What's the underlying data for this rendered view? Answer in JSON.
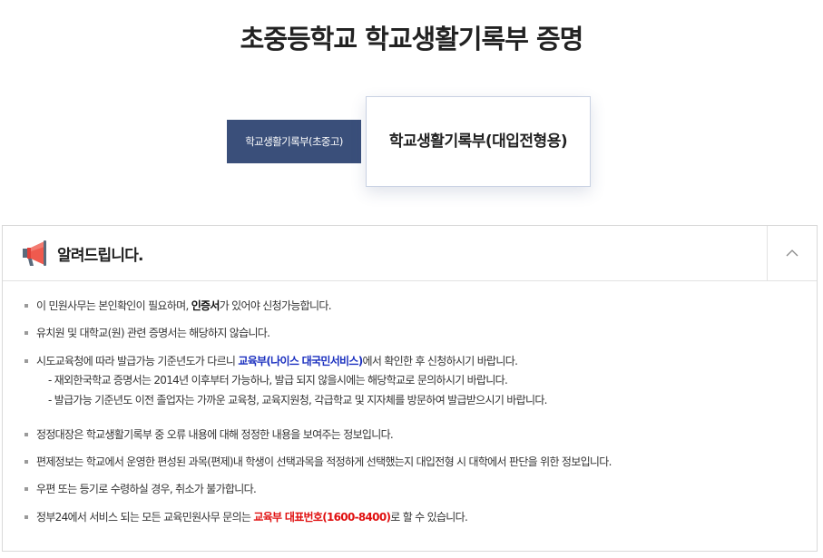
{
  "page": {
    "title": "초중등학교 학교생활기록부 증명"
  },
  "tabs": {
    "basic_label": "학교생활기록부(초중고)",
    "admission_label": "학교생활기록부(대입전형용)"
  },
  "notice": {
    "header_title": "알려드립니다.",
    "items": [
      {
        "pre": "이 민원사무는 본인확인이 필요하며, ",
        "em": "인증서",
        "post": "가 있어야 신청가능합니다."
      },
      {
        "text": "유치원 및 대학교(원) 관련 증명서는 해당하지 않습니다."
      },
      {
        "pre": "시도교육청에 따라 발급가능 기준년도가 다르니 ",
        "em": "교육부(나이스 대국민서비스)",
        "post": "에서 확인한 후 신청하시기 바랍니다."
      },
      {
        "text": "정정대장은 학교생활기록부 중 오류 내용에 대해 정정한 내용을 보여주는 정보입니다."
      },
      {
        "text": "편제정보는 학교에서 운영한 편성된 과목(편제)내 학생이 선택과목을 적정하게 선택했는지 대입전형 시 대학에서 판단을 위한 정보입니다."
      },
      {
        "text": "우편 또는 등기로 수령하실 경우, 취소가 불가합니다."
      },
      {
        "pre": "정부24에서 서비스 되는 모든 교육민원사무 문의는 ",
        "em": "교육부 대표번호(1600-8400)",
        "post": "로 할 수 있습니다."
      }
    ],
    "sub_items": [
      "- 재외한국학교 증명서는 2014년 이후부터 가능하나, 발급 되지 않을시에는 해당학교로 문의하시기 바랍니다.",
      "- 발급가능 기준년도 이전 졸업자는 가까운 교육청, 교육지원청, 각급학교 및 지자체를 방문하여 발급받으시기 바랍니다."
    ]
  },
  "icons": {
    "megaphone": "megaphone-icon",
    "toggle": "chevron-up-icon"
  },
  "colors": {
    "tab_active_bg": "#3a4f7a",
    "link_blue": "#1a2fbf",
    "phone_red": "#e01010"
  }
}
